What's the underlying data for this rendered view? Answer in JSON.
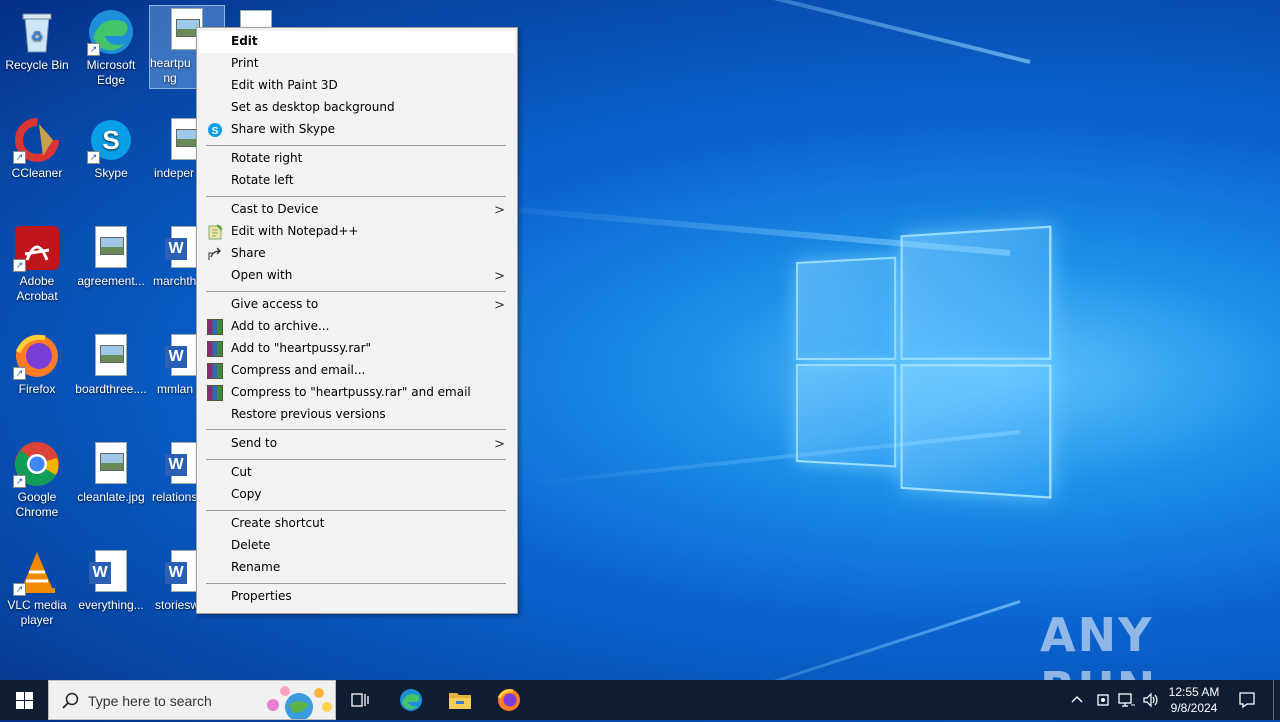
{
  "desktop": {
    "icons": [
      {
        "label": "Recycle Bin"
      },
      {
        "label": "Microsoft Edge"
      },
      {
        "label": "heartpu ng"
      },
      {
        "label": "CCleaner"
      },
      {
        "label": "Skype"
      },
      {
        "label": "indeper"
      },
      {
        "label": "Adobe Acrobat"
      },
      {
        "label": "agreement..."
      },
      {
        "label": "marchth"
      },
      {
        "label": "Firefox"
      },
      {
        "label": "boardthree...."
      },
      {
        "label": "mmlan"
      },
      {
        "label": "Google Chrome"
      },
      {
        "label": "cleanlate.jpg"
      },
      {
        "label": "relations"
      },
      {
        "label": "VLC media player"
      },
      {
        "label": "everything..."
      },
      {
        "label": "storiesw"
      }
    ]
  },
  "context_menu": {
    "items": [
      {
        "label": "Edit"
      },
      {
        "label": "Print"
      },
      {
        "label": "Edit with Paint 3D"
      },
      {
        "label": "Set as desktop background"
      },
      {
        "label": "Share with Skype"
      },
      {
        "label": "Rotate right"
      },
      {
        "label": "Rotate left"
      },
      {
        "label": "Cast to Device"
      },
      {
        "label": "Edit with Notepad++"
      },
      {
        "label": "Share"
      },
      {
        "label": "Open with"
      },
      {
        "label": "Give access to"
      },
      {
        "label": "Add to archive..."
      },
      {
        "label": "Add to \"heartpussy.rar\""
      },
      {
        "label": "Compress and email..."
      },
      {
        "label": "Compress to \"heartpussy.rar\" and email"
      },
      {
        "label": "Restore previous versions"
      },
      {
        "label": "Send to"
      },
      {
        "label": "Cut"
      },
      {
        "label": "Copy"
      },
      {
        "label": "Create shortcut"
      },
      {
        "label": "Delete"
      },
      {
        "label": "Rename"
      },
      {
        "label": "Properties"
      }
    ]
  },
  "taskbar": {
    "search_placeholder": "Type here to search",
    "time": "12:55 AM",
    "date": "9/8/2024"
  },
  "watermark": "ANY RUN",
  "icons": {
    "start": "windows-logo-icon",
    "task_view": "task-view-icon",
    "edge": "edge-icon",
    "explorer": "file-explorer-icon",
    "firefox": "firefox-icon"
  },
  "colors": {
    "taskbar": "#101e33",
    "menu_bg": "#f2f2f2",
    "accent": "#0a63cf"
  }
}
